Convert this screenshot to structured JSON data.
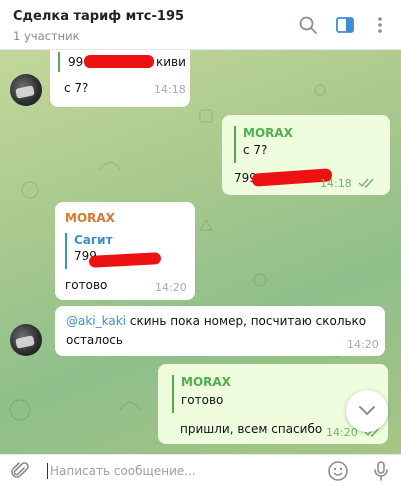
{
  "header": {
    "title": "Сделка тариф мтс-195",
    "subtitle": "1 участник"
  },
  "messages": {
    "m1": {
      "line1_prefix": "99",
      "line1_suffix": "киви",
      "line2": "с 7?",
      "time": "14:18"
    },
    "m2": {
      "quote_name": "MORAX",
      "quote_text": "с 7?",
      "body_prefix": "799",
      "time": "14:18"
    },
    "m3": {
      "sender": "MORAX",
      "quote_name": "Сагит",
      "quote_text_prefix": "799",
      "body": "готово",
      "time": "14:20"
    },
    "m4": {
      "mention": "@aki_kaki",
      "line1": "скинь пока номер, посчитаю сколько",
      "line2": "осталось",
      "time": "14:20"
    },
    "m5": {
      "quote_name": "MORAX",
      "quote_text": "готово",
      "body": "пришли, всем спасибо",
      "time": "14:20"
    }
  },
  "composer": {
    "placeholder": "Написать сообщение..."
  },
  "colors": {
    "accent_green": "#4fae4e",
    "accent_blue": "#3a8fd6",
    "sender_orange": "#d9782c",
    "outgoing_bubble": "#effdde",
    "redaction": "#ee1111"
  }
}
